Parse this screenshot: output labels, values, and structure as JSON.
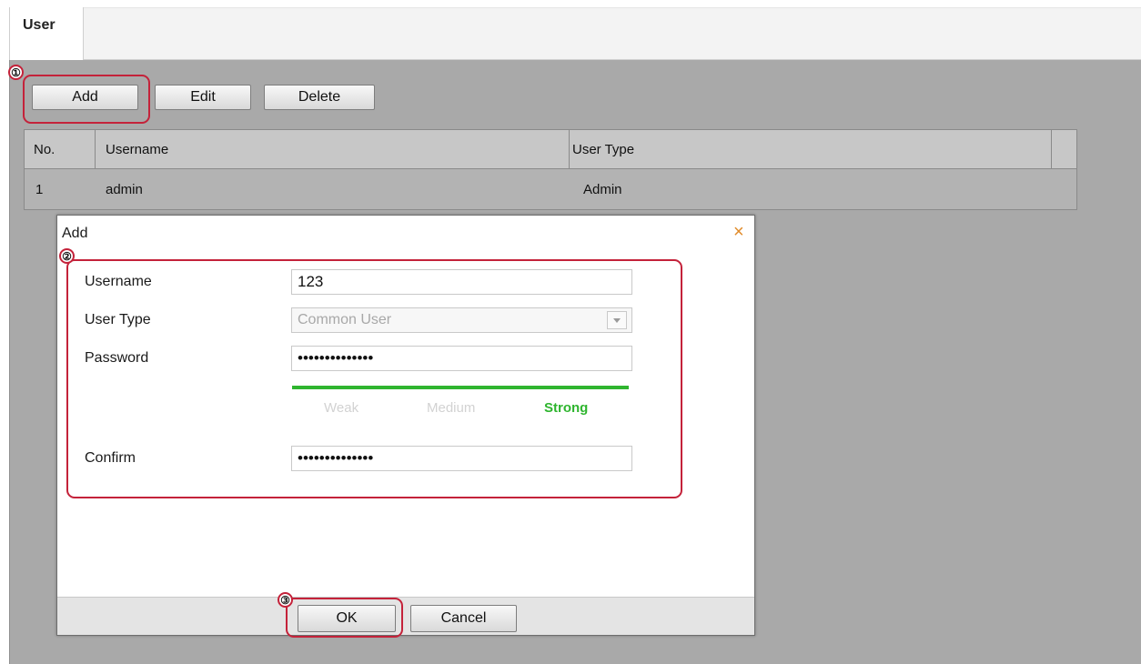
{
  "tabs": [
    {
      "label": "User"
    }
  ],
  "toolbar": {
    "add": "Add",
    "edit": "Edit",
    "delete": "Delete"
  },
  "table": {
    "columns": [
      "No.",
      "Username",
      "User Type"
    ],
    "rows": [
      {
        "no": "1",
        "username": "admin",
        "user_type": "Admin"
      }
    ]
  },
  "dialog": {
    "title": "Add",
    "close_glyph": "×",
    "username_label": "Username",
    "username_value": "123",
    "user_type_label": "User Type",
    "user_type_value": "Common User",
    "password_label": "Password",
    "password_value": "••••••••••••••",
    "strength": {
      "weak": "Weak",
      "medium": "Medium",
      "strong": "Strong",
      "level": "Strong"
    },
    "confirm_label": "Confirm",
    "confirm_value": "••••••••••••••",
    "ok": "OK",
    "cancel": "Cancel"
  },
  "callouts": [
    "①",
    "②",
    "③"
  ],
  "colors": {
    "callout": "#c4223a",
    "strength_strong": "#2fb52f",
    "close": "#e08b2a"
  }
}
